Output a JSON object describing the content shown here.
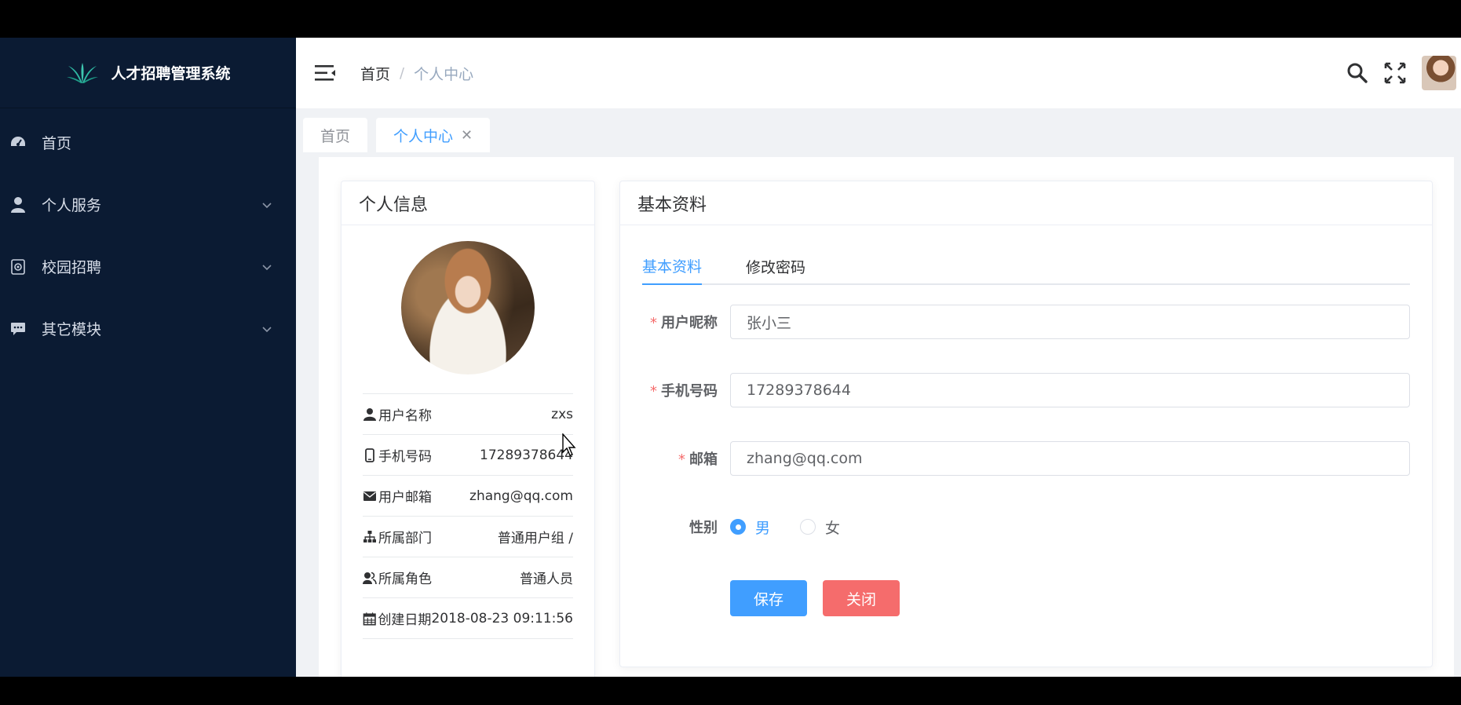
{
  "app": {
    "title": "人才招聘管理系统"
  },
  "sidebar": {
    "items": [
      {
        "label": "首页",
        "icon": "dashboard-icon",
        "expandable": false
      },
      {
        "label": "个人服务",
        "icon": "user-icon",
        "expandable": true
      },
      {
        "label": "校园招聘",
        "icon": "campus-icon",
        "expandable": true
      },
      {
        "label": "其它模块",
        "icon": "chat-icon",
        "expandable": true
      }
    ]
  },
  "header": {
    "breadcrumb": {
      "home": "首页",
      "separator": "/",
      "current": "个人中心"
    }
  },
  "tags": [
    {
      "label": "首页",
      "active": false
    },
    {
      "label": "个人中心",
      "active": true,
      "close": "✕"
    }
  ],
  "profile_card": {
    "title": "个人信息",
    "rows": [
      {
        "icon": "user-icon",
        "label": "用户名称",
        "value": "zxs"
      },
      {
        "icon": "phone-icon",
        "label": "手机号码",
        "value": "17289378644"
      },
      {
        "icon": "mail-icon",
        "label": "用户邮箱",
        "value": "zhang@qq.com"
      },
      {
        "icon": "org-tree-icon",
        "label": "所属部门",
        "value": "普通用户组 /"
      },
      {
        "icon": "peoples-icon",
        "label": "所属角色",
        "value": "普通人员"
      },
      {
        "icon": "calendar-icon",
        "label": "创建日期",
        "value": "2018-08-23 09:11:56"
      }
    ]
  },
  "basic_card": {
    "title": "基本资料",
    "tabs": [
      {
        "label": "基本资料",
        "active": true
      },
      {
        "label": "修改密码",
        "active": false
      }
    ],
    "form": {
      "nickname": {
        "label": "用户昵称",
        "required": "*",
        "value": "张小三"
      },
      "phone": {
        "label": "手机号码",
        "required": "*",
        "value": "17289378644"
      },
      "email": {
        "label": "邮箱",
        "required": "*",
        "value": "zhang@qq.com"
      },
      "gender": {
        "label": "性别",
        "options": [
          "男",
          "女"
        ],
        "selected": "男"
      }
    },
    "buttons": {
      "save": "保存",
      "close": "关闭"
    }
  },
  "colors": {
    "sidebar_bg": "#0b1b33",
    "primary": "#409eff",
    "danger": "#f56c6c"
  }
}
